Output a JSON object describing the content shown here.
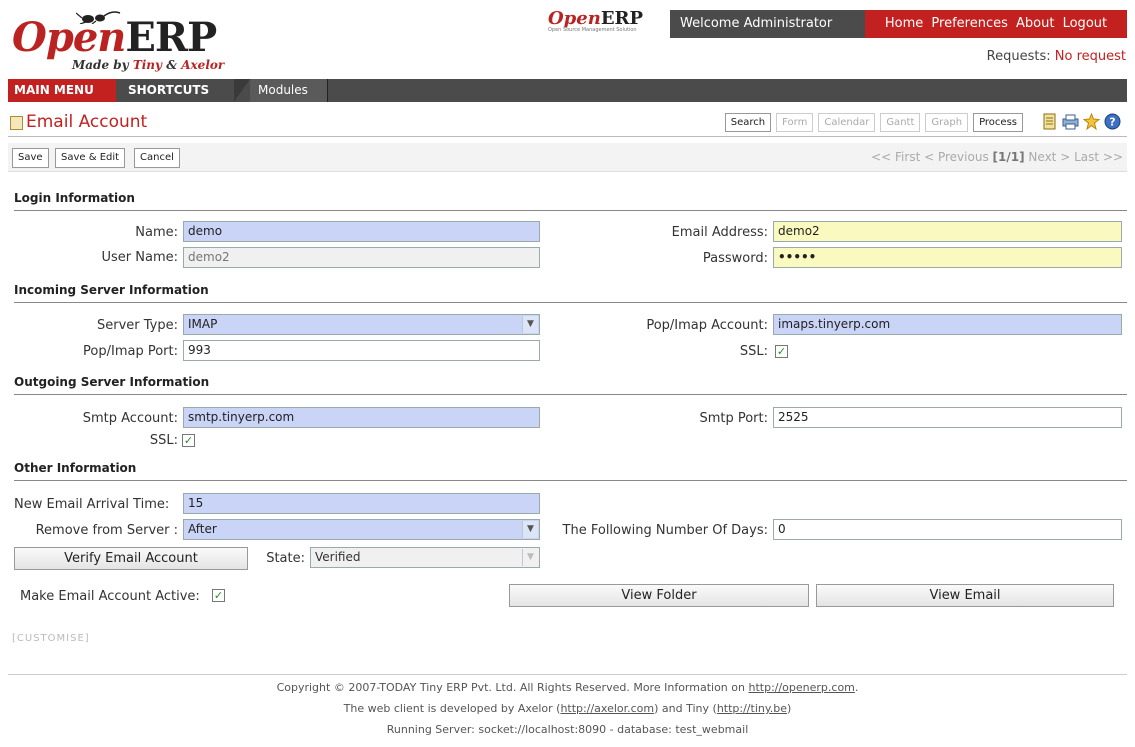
{
  "header": {
    "logo": {
      "open": "Open",
      "erp": "ERP",
      "made_prefix": "Made by",
      "tiny": "Tiny",
      "amp": "&",
      "axelor": "Axelor"
    },
    "small_logo": {
      "text_open": "Open",
      "text_erp": "ERP",
      "tagline": "Open Source Management Solution"
    },
    "welcome": "Welcome Administrator",
    "links": [
      "Home",
      "Preferences",
      "About",
      "Logout"
    ],
    "requests_label": "Requests:",
    "requests_value": "No request"
  },
  "menu": {
    "main_menu": "MAIN MENU",
    "shortcuts": "SHORTCUTS",
    "modules": "Modules"
  },
  "title_bar": {
    "title": "Email Account",
    "views": [
      {
        "label": "Search",
        "enabled": true
      },
      {
        "label": "Form",
        "enabled": false
      },
      {
        "label": "Calendar",
        "enabled": false
      },
      {
        "label": "Gantt",
        "enabled": false
      },
      {
        "label": "Graph",
        "enabled": false
      },
      {
        "label": "Process",
        "enabled": true
      }
    ],
    "icons": [
      "notes-icon",
      "print-icon",
      "new-icon",
      "help-icon"
    ]
  },
  "actions": {
    "save": "Save",
    "save_edit": "Save & Edit",
    "cancel": "Cancel",
    "pager": {
      "first": "<< First",
      "previous": "< Previous",
      "position": "[1/1]",
      "next": "Next >",
      "last": "Last >>"
    }
  },
  "form": {
    "login_section": "Login Information",
    "name_label": "Name:",
    "name_value": "demo",
    "username_label": "User Name:",
    "username_value": "demo2",
    "email_label": "Email Address:",
    "email_value": "demo2",
    "password_label": "Password:",
    "password_value": "•••••",
    "incoming_section": "Incoming Server Information",
    "server_type_label": "Server Type:",
    "server_type_value": "IMAP",
    "popimap_port_label": "Pop/Imap Port:",
    "popimap_port_value": "993",
    "popimap_account_label": "Pop/Imap Account:",
    "popimap_account_value": "imaps.tinyerp.com",
    "ssl_in_label": "SSL:",
    "ssl_in_checked": true,
    "outgoing_section": "Outgoing Server Information",
    "smtp_account_label": "Smtp Account:",
    "smtp_account_value": "smtp.tinyerp.com",
    "ssl_out_label": "SSL:",
    "ssl_out_checked": true,
    "smtp_port_label": "Smtp Port:",
    "smtp_port_value": "2525",
    "other_section": "Other Information",
    "arrival_label": "New Email Arrival Time:",
    "arrival_value": "15",
    "remove_label": "Remove from Server :",
    "remove_value": "After",
    "days_label": "The Following Number Of Days:",
    "days_value": "0",
    "verify_button": "Verify Email Account",
    "state_label": "State:",
    "state_value": "Verified",
    "active_label": "Make Email Account Active:",
    "active_checked": true,
    "view_folder_button": "View Folder",
    "view_email_button": "View Email"
  },
  "customise": "[CUSTOMISE]",
  "footer": {
    "line1_text": "Copyright © 2007-TODAY Tiny ERP Pvt. Ltd. All Rights Reserved. More Information on",
    "line1_link": "http://openerp.com",
    "line1_end": ".",
    "line2_a": "The web client is developed by Axelor (",
    "line2_link1": "http://axelor.com",
    "line2_b": ") and Tiny (",
    "line2_link2": "http://tiny.be",
    "line2_c": ")",
    "line3": "Running Server: socket://localhost:8090 - database: test_webmail"
  },
  "colors": {
    "brand_red": "#c3211f",
    "dark_bar": "#4b4b4b",
    "field_blue": "#c9d4f7",
    "field_yellow": "#fafac0"
  }
}
